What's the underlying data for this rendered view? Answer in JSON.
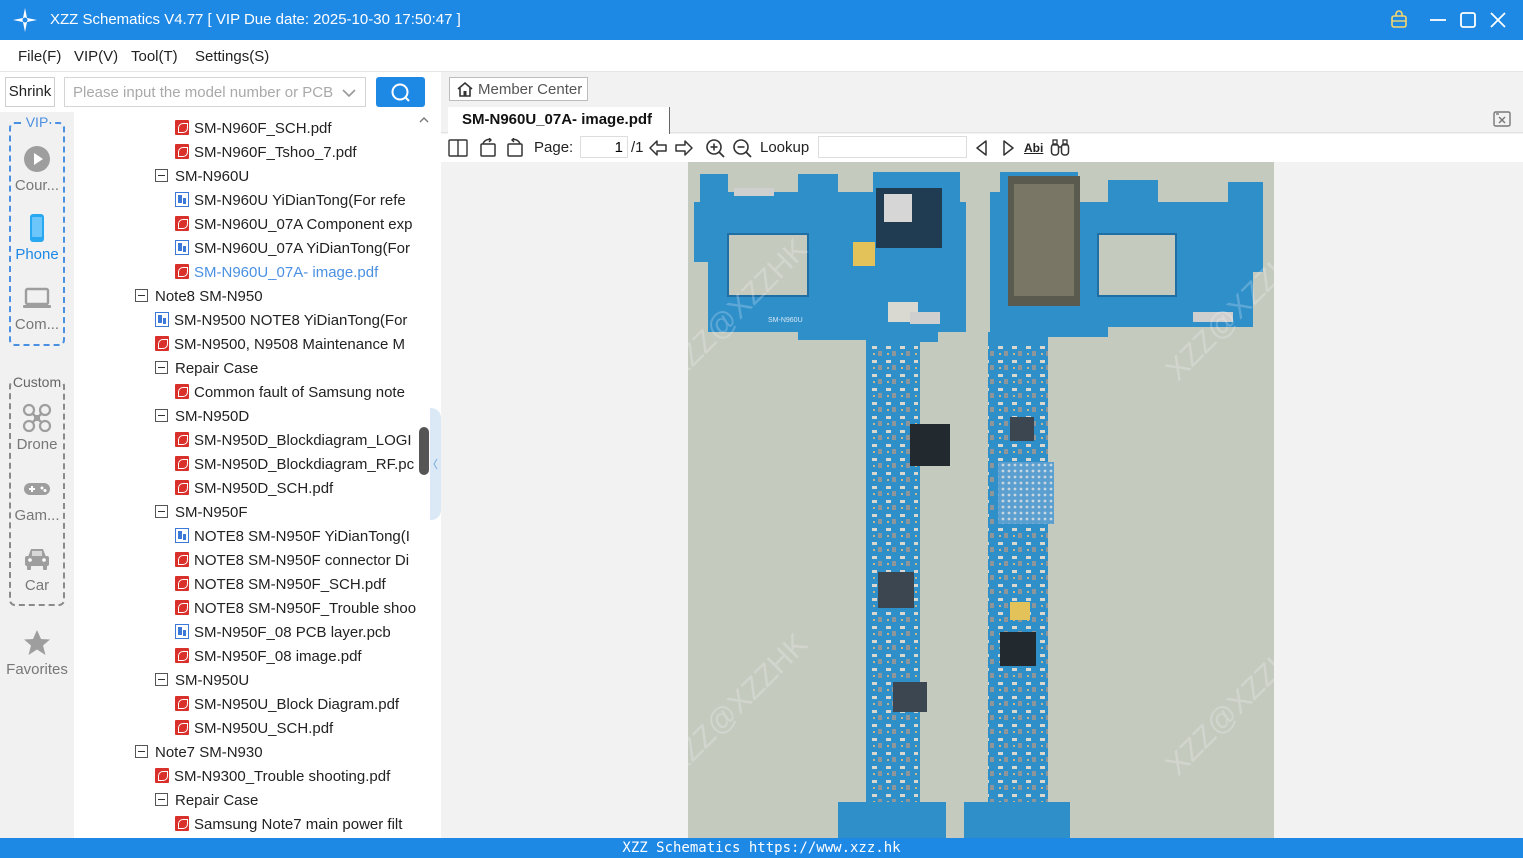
{
  "titlebar": {
    "title": "XZZ Schematics V4.77 [ VIP Due date: 2025-10-30 17:50:47 ]"
  },
  "menu": [
    "File(F)",
    "VIP(V)",
    "Tool(T)",
    "Settings(S)"
  ],
  "toolbar": {
    "shrink_label": "Shrink",
    "search_placeholder": "Please input the model number or PCB"
  },
  "rail": {
    "vip_label": "VIP",
    "custom_label": "Custom",
    "items": [
      {
        "label": "Cour...",
        "icon": "play-circle-icon"
      },
      {
        "label": "Phone",
        "icon": "phone-icon"
      },
      {
        "label": "Com...",
        "icon": "laptop-icon"
      },
      {
        "label": "Drone",
        "icon": "drone-icon"
      },
      {
        "label": "Gam...",
        "icon": "gamepad-icon"
      },
      {
        "label": "Car",
        "icon": "car-icon"
      },
      {
        "label": "Favorites",
        "icon": "star-icon"
      }
    ]
  },
  "tree": [
    {
      "label": "SM-N960F_SCH.pdf",
      "type": "pdf",
      "indent": 2
    },
    {
      "label": "SM-N960F_Tshoo_7.pdf",
      "type": "pdf",
      "indent": 2
    },
    {
      "label": "SM-N960U",
      "type": "folder",
      "indent": 1
    },
    {
      "label": "SM-N960U YiDianTong(For refe",
      "type": "pcb",
      "indent": 2
    },
    {
      "label": "SM-N960U_07A Component exp",
      "type": "pdf",
      "indent": 2
    },
    {
      "label": "SM-N960U_07A YiDianTong(For",
      "type": "pcb",
      "indent": 2
    },
    {
      "label": "SM-N960U_07A- image.pdf",
      "type": "pdf",
      "indent": 2,
      "selected": true
    },
    {
      "label": "Note8 SM-N950",
      "type": "folder",
      "indent": 0
    },
    {
      "label": "SM-N9500 NOTE8 YiDianTong(For",
      "type": "pcb",
      "indent": 1
    },
    {
      "label": "SM-N9500, N9508 Maintenance M",
      "type": "pdf",
      "indent": 1
    },
    {
      "label": "Repair Case",
      "type": "folder",
      "indent": 1
    },
    {
      "label": "Common fault of Samsung note",
      "type": "pdf",
      "indent": 2
    },
    {
      "label": "SM-N950D",
      "type": "folder",
      "indent": 1
    },
    {
      "label": "SM-N950D_Blockdiagram_LOGI",
      "type": "pdf",
      "indent": 2
    },
    {
      "label": "SM-N950D_Blockdiagram_RF.pc",
      "type": "pdf",
      "indent": 2
    },
    {
      "label": "SM-N950D_SCH.pdf",
      "type": "pdf",
      "indent": 2
    },
    {
      "label": "SM-N950F",
      "type": "folder",
      "indent": 1
    },
    {
      "label": "NOTE8 SM-N950F YiDianTong(I",
      "type": "pcb",
      "indent": 2
    },
    {
      "label": "NOTE8 SM-N950F connector Di",
      "type": "pdf",
      "indent": 2
    },
    {
      "label": "NOTE8 SM-N950F_SCH.pdf",
      "type": "pdf",
      "indent": 2
    },
    {
      "label": "NOTE8 SM-N950F_Trouble shoo",
      "type": "pdf",
      "indent": 2
    },
    {
      "label": "SM-N950F_08 PCB layer.pcb",
      "type": "pcb",
      "indent": 2
    },
    {
      "label": "SM-N950F_08 image.pdf",
      "type": "pdf",
      "indent": 2
    },
    {
      "label": "SM-N950U",
      "type": "folder",
      "indent": 1
    },
    {
      "label": "SM-N950U_Block Diagram.pdf",
      "type": "pdf",
      "indent": 2
    },
    {
      "label": "SM-N950U_SCH.pdf",
      "type": "pdf",
      "indent": 2
    },
    {
      "label": "Note7 SM-N930",
      "type": "folder",
      "indent": 0
    },
    {
      "label": "SM-N9300_Trouble shooting.pdf",
      "type": "pdf",
      "indent": 1
    },
    {
      "label": "Repair Case",
      "type": "folder",
      "indent": 1
    },
    {
      "label": "Samsung Note7 main power filt",
      "type": "pdf",
      "indent": 2
    }
  ],
  "viewer": {
    "member_center_label": "Member Center",
    "tab_label": "SM-N960U_07A- image.pdf",
    "page_label": "Page:",
    "page_current": "1",
    "page_total": "/1",
    "lookup_label": "Lookup",
    "lookup_value": "",
    "find_text_icon_label": "Abi"
  },
  "statusbar": {
    "text": "XZZ Schematics https://www.xzz.hk"
  },
  "colors": {
    "brand_blue": "#1e88e5",
    "pcb_blue": "#2f8fc9",
    "pcb_background": "#c5cabf",
    "selected_text": "#4a90e2"
  }
}
